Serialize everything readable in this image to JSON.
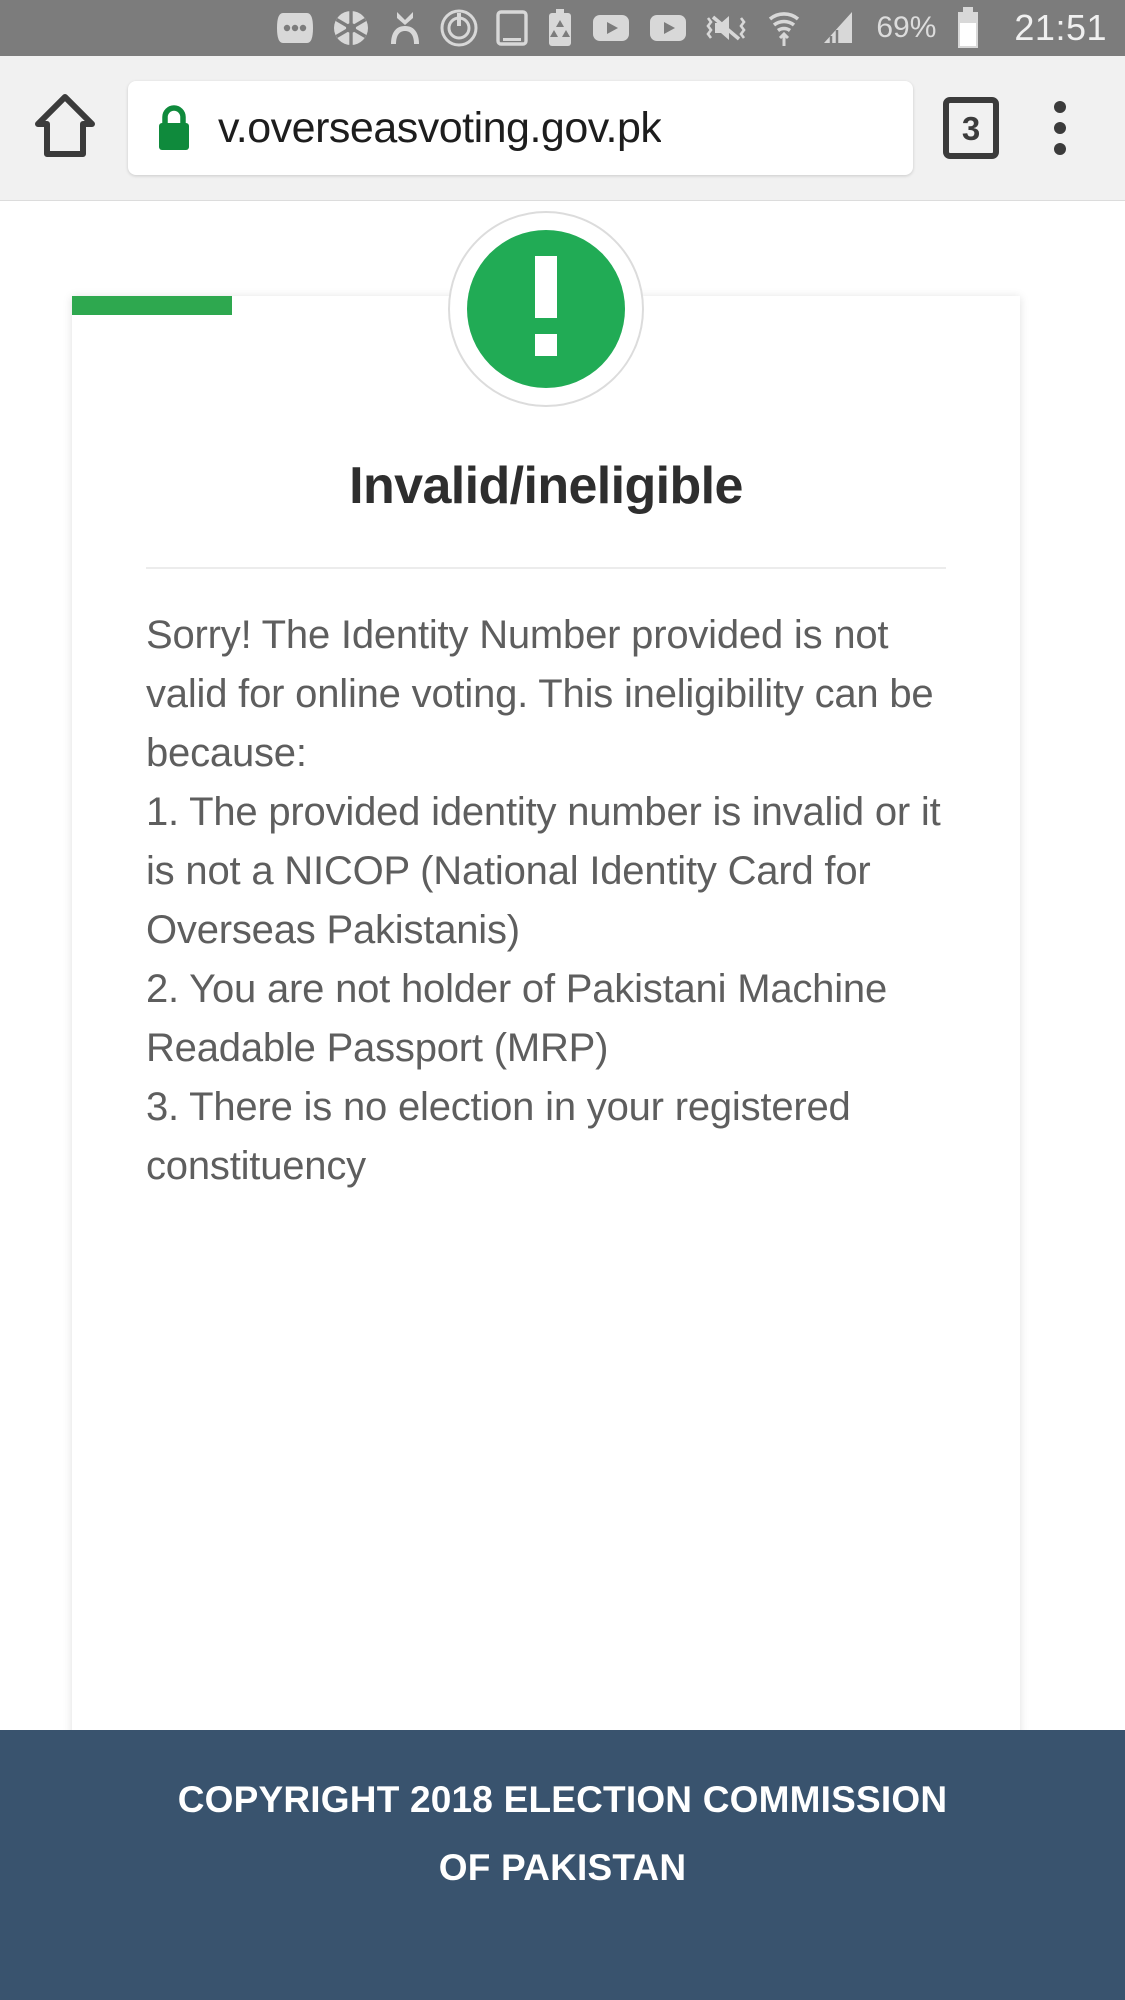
{
  "status_bar": {
    "icons": [
      "more-options-icon",
      "aperture-icon",
      "contacts-sync-icon",
      "power-saver-icon",
      "tablet-icon",
      "battery-recycle-icon",
      "youtube-icon",
      "youtube-play-icon",
      "mute-vibrate-icon",
      "wifi-icon",
      "signal-bars-icon"
    ],
    "battery_percent": "69%",
    "clock": "21:51"
  },
  "browser": {
    "home_label": "home-icon",
    "lock_label": "lock-icon",
    "url": "v.overseasvoting.gov.pk",
    "tab_count": "3",
    "menu_label": "overflow-menu-icon"
  },
  "page": {
    "badge_icon": "exclamation-icon",
    "title": "Invalid/ineligible",
    "intro": "Sorry! The Identity Number provided is not valid for online voting. This ineligibility can be because:",
    "reasons": [
      "1. The provided identity number is invalid or it is not a NICOP (National Identity Card for Overseas Pakistanis)",
      "2. You are not holder of Pakistani Machine Readable Passport (MRP)",
      "3. There is no election in your registered constituency"
    ]
  },
  "footer": {
    "copyright": "COPYRIGHT 2018 ELECTION COMMISSION OF PAKISTAN"
  },
  "colors": {
    "accent_green": "#2ea84f",
    "badge_green": "#21ab55",
    "footer_blue": "#39536e",
    "status_gray": "#7c7c7c"
  }
}
